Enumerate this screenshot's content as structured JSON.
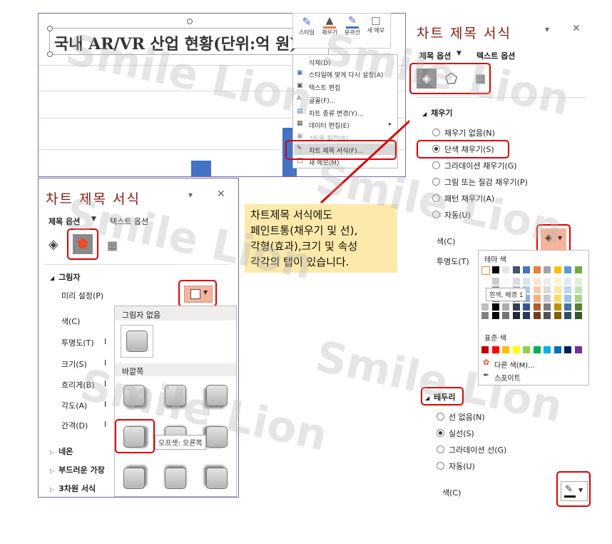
{
  "watermark": "Smile Lion",
  "chart_area": {
    "title": "국내 AR/VR 산업 현황(단위:억 원)",
    "bar_color": "#4472c4"
  },
  "mini_toolbar": {
    "items": [
      {
        "label": "스타일",
        "icon": "brush-icon"
      },
      {
        "label": "채우기",
        "icon": "paint-bucket-icon"
      },
      {
        "label": "윤곽선",
        "icon": "pen-outline-icon"
      },
      {
        "label": "새 메모",
        "icon": "comment-icon"
      }
    ]
  },
  "context_menu": {
    "items": [
      {
        "label": "삭제(D)",
        "icon": ""
      },
      {
        "label": "스타일에 맞게 다시 설정(A)",
        "icon": "reset-icon"
      },
      {
        "label": "텍스트 편집",
        "icon": "text-icon"
      },
      {
        "label": "글꼴(F)...",
        "icon": "font-icon"
      },
      {
        "label": "차트 종류 변경(Y)...",
        "icon": "chart-icon"
      },
      {
        "label": "데이터 편집(E)",
        "icon": "table-icon"
      },
      {
        "label": "3차원 회전(R)...",
        "icon": "rotate-icon"
      },
      {
        "label": "차트 제목 서식(F)...",
        "icon": "format-icon"
      },
      {
        "label": "새 메모(M)",
        "icon": "comment-icon"
      }
    ],
    "highlighted": "차트 제목 서식(F)..."
  },
  "left_panel": {
    "title": "차트 제목 서식",
    "tab_options": "제목 옵션",
    "tab_text": "텍스트 옵션",
    "section_shadow": "그림자",
    "preset_label": "미리 설정(P)",
    "color_label": "색(C)",
    "transparency_label": "투명도(T)",
    "size_label": "크기(S)",
    "blur_label": "흐리게(B)",
    "angle_label": "각도(A)",
    "distance_label": "간격(D)",
    "glow_label": "네온",
    "soft_edges_label": "부드러운 가장",
    "three_d_label": "3차원 서식",
    "dropdown": {
      "no_shadow": "그림자 없음",
      "outer": "바깥쪽",
      "tooltip": "오프셋: 오른쪽"
    }
  },
  "right_panel": {
    "title": "차트 제목 서식",
    "tab_options": "제목 옵션",
    "tab_text": "텍스트 옵션",
    "section_fill": "채우기",
    "fill_options": [
      {
        "label": "채우기 없음(N)",
        "checked": false
      },
      {
        "label": "단색 채우기(S)",
        "checked": true
      },
      {
        "label": "그라데이션 채우기(G)",
        "checked": false
      },
      {
        "label": "그림 또는 질감 채우기(P)",
        "checked": false
      },
      {
        "label": "패턴 채우기(A)",
        "checked": false
      },
      {
        "label": "자동(U)",
        "checked": false
      }
    ],
    "color_label": "색(C)",
    "transparency_label": "투명도(T)",
    "section_border": "테두리",
    "border_options": [
      {
        "label": "선 없음(N)",
        "checked": false
      },
      {
        "label": "실선(S)",
        "checked": true
      },
      {
        "label": "그라데이션 선(G)",
        "checked": false
      },
      {
        "label": "자동(U)",
        "checked": false
      }
    ],
    "border_color_label": "색(C)",
    "color_picker": {
      "theme_label": "테마 색",
      "tooltip": "흰색, 배경 1",
      "standard_label": "표준 색",
      "more_colors": "다른 색(M)...",
      "eyedropper": "스포이트",
      "theme_colors": [
        "#ffffff",
        "#000000",
        "#e7e6e6",
        "#44546a",
        "#4472c4",
        "#ed7d31",
        "#a5a5a5",
        "#ffc000",
        "#5b9bd5",
        "#70ad47"
      ],
      "standard_colors": [
        "#c00000",
        "#ff0000",
        "#ffc000",
        "#ffff00",
        "#92d050",
        "#00b050",
        "#00b0f0",
        "#0070c0",
        "#002060",
        "#7030a0"
      ]
    }
  },
  "callout": {
    "lines": [
      "차트제목 서식에도",
      "페인트통(채우기 및 선),",
      "각형(효과),크기 및 속성",
      "각각의 탭이 있습니다."
    ]
  }
}
